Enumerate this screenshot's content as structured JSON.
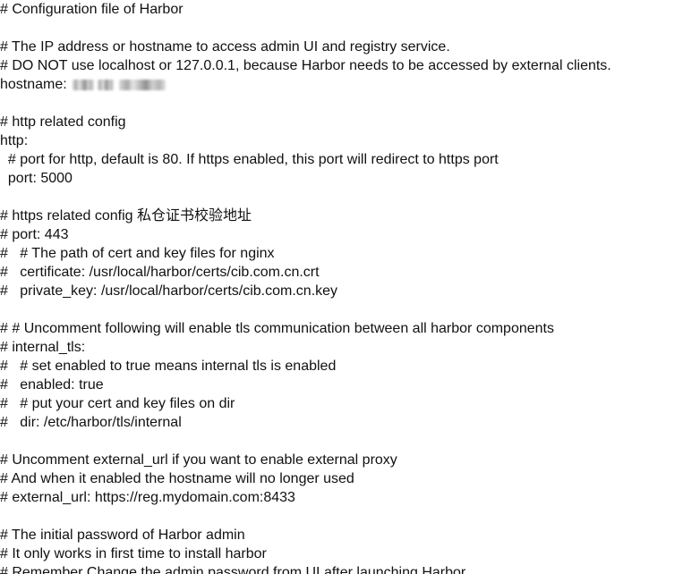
{
  "lines": [
    "# Configuration file of Harbor",
    "",
    "# The IP address or hostname to access admin UI and registry service.",
    "# DO NOT use localhost or 127.0.0.1, because Harbor needs to be accessed by external clients.",
    "hostname:",
    "",
    "# http related config",
    "http:",
    "  # port for http, default is 80. If https enabled, this port will redirect to https port",
    "  port: 5000",
    "",
    "# https related config 私仓证书校验地址",
    "# port: 443",
    "#   # The path of cert and key files for nginx",
    "#   certificate: /usr/local/harbor/certs/cib.com.cn.crt",
    "#   private_key: /usr/local/harbor/certs/cib.com.cn.key",
    "",
    "# # Uncomment following will enable tls communication between all harbor components",
    "# internal_tls:",
    "#   # set enabled to true means internal tls is enabled",
    "#   enabled: true",
    "#   # put your cert and key files on dir",
    "#   dir: /etc/harbor/tls/internal",
    "",
    "# Uncomment external_url if you want to enable external proxy",
    "# And when it enabled the hostname will no longer used",
    "# external_url: https://reg.mydomain.com:8433",
    "",
    "# The initial password of Harbor admin",
    "# It only works in first time to install harbor",
    "# Remember Change the admin password from UI after launching Harbor."
  ]
}
